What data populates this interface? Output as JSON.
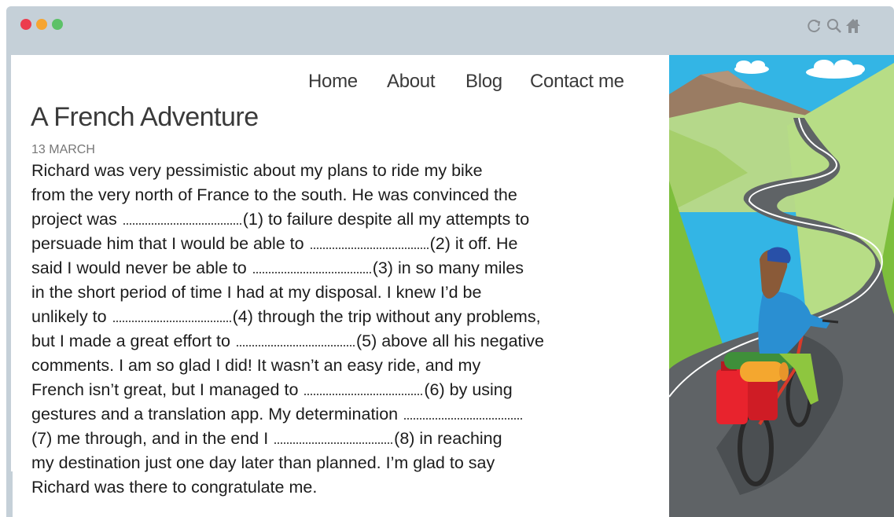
{
  "browser": {
    "icons": [
      "refresh-icon",
      "search-icon",
      "home-icon"
    ]
  },
  "nav": {
    "items": [
      "Home",
      "About",
      "Blog",
      "Contact me"
    ]
  },
  "article": {
    "title": "A French Adventure",
    "date": "13 MARCH",
    "lines": [
      [
        "Richard was very pessimistic about my plans to ride my bike"
      ],
      [
        "from the very north of France to the south. He was convinced the"
      ],
      [
        "project was ",
        "(1) to failure despite all my attempts to"
      ],
      [
        "persuade him that I would be able to ",
        "(2) it off. He"
      ],
      [
        "said I would never be able to ",
        "(3) in so many miles"
      ],
      [
        "in the short period of time I had at my disposal. I knew I’d be"
      ],
      [
        "unlikely to ",
        "(4) through the trip without any problems,"
      ],
      [
        "but I made a great effort to ",
        "(5) above all his negative"
      ],
      [
        "comments. I am so glad I did! It wasn’t an easy ride, and my"
      ],
      [
        "French isn’t great, but I managed to ",
        "(6) by using"
      ],
      [
        "gestures and a translation app. My determination ",
        ""
      ],
      [
        "(7) me through, and in the end I ",
        "(8) in reaching"
      ],
      [
        "my destination just one day later than planned. I’m glad to say"
      ],
      [
        "Richard was there to congratulate me."
      ]
    ]
  },
  "colors": {
    "chrome": "#c5d0d8",
    "sky": "#33b5e5",
    "grass": "#7dbe3c",
    "road": "#5f6366",
    "mountain": "#9a7c63"
  }
}
